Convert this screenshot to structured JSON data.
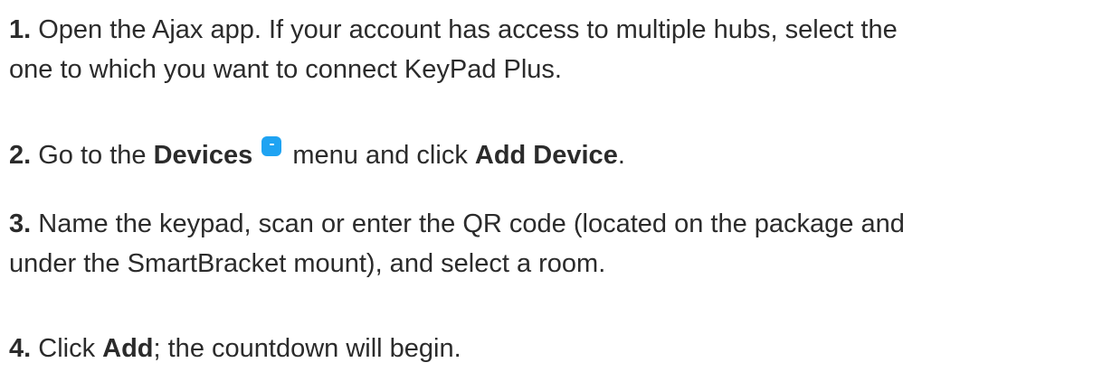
{
  "colors": {
    "text": "#2b2b2b",
    "devices_icon": "#1fa3f2"
  },
  "steps": [
    {
      "number": "1.",
      "line1": " Open the Ajax app. If your account has access to multiple hubs, select the",
      "line2": "one to which you want to connect KeyPad Plus."
    },
    {
      "number": "2.",
      "text_before": " Go to the ",
      "bold1": "Devices",
      "icon": "devices-icon",
      "text_middle": " menu and click ",
      "bold2": "Add Device",
      "text_after": "."
    },
    {
      "number": "3.",
      "line1": " Name the keypad, scan or enter the QR code (located on the package and",
      "line2": "under the SmartBracket mount), and select a room."
    },
    {
      "number": "4.",
      "text_before": " Click ",
      "bold1": "Add",
      "text_after": "; the countdown will begin."
    }
  ]
}
